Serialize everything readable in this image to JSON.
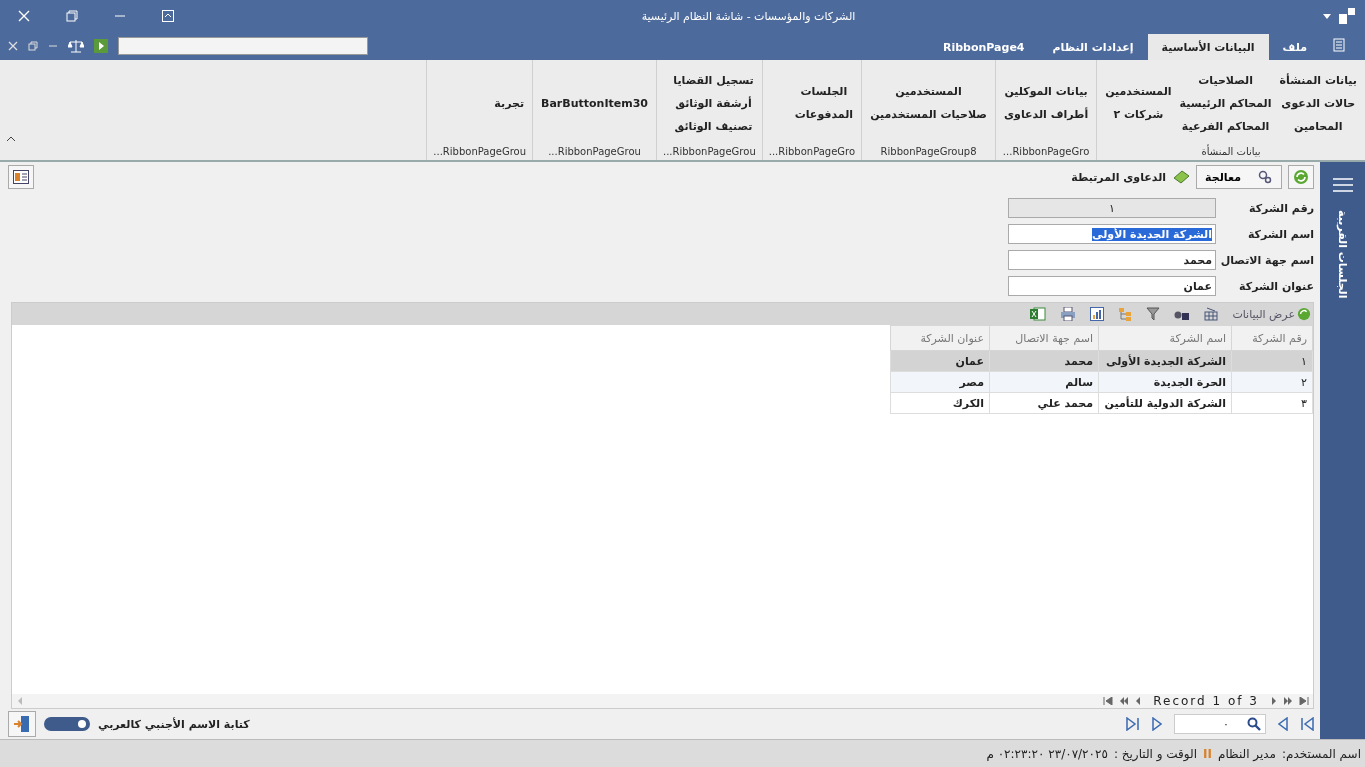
{
  "window": {
    "title": "الشركات والمؤسسات - شاشة النظام الرئيسية"
  },
  "ribbon": {
    "tabs": [
      {
        "label": "ملف",
        "selected": false
      },
      {
        "label": "البيانات الأساسية",
        "selected": true
      },
      {
        "label": "إعدادات النظام",
        "selected": false
      },
      {
        "label": "RibbonPage4",
        "selected": false
      }
    ],
    "groups": [
      {
        "caption": "بيانات المنشأة",
        "columns": [
          [
            "بيانات المنشأة",
            "حالات الدعوى",
            "المحامين"
          ],
          [
            "الصلاحيات",
            "المحاكم الرئيسية",
            "المحاكم الفرعية"
          ],
          [
            "المستخدمين",
            "شركات ٢"
          ]
        ]
      },
      {
        "caption": "RibbonPageGro...",
        "columns": [
          [
            "بيانات الموكلين",
            "أطراف الدعاوى"
          ]
        ]
      },
      {
        "caption": "RibbonPageGroup8",
        "columns": [
          [
            "المستخدمين",
            "صلاحيات المستخدمين"
          ]
        ]
      },
      {
        "caption": "RibbonPageGro...",
        "columns": [
          [
            "الجلسات",
            "المدفوعات"
          ]
        ]
      },
      {
        "caption": "RibbonPageGrou...",
        "columns": [
          [
            "تسجيل القضايا",
            "أرشفة الوثائق",
            "تصنيف الوثائق"
          ]
        ]
      },
      {
        "caption": "RibbonPageGrou...",
        "columns": [
          [
            "BarButtonItem30"
          ]
        ]
      },
      {
        "caption": "RibbonPageGrou...",
        "columns": [
          [
            "تجربة"
          ]
        ]
      }
    ]
  },
  "side_panel": {
    "title": "الجلسات القريبة"
  },
  "toolbar": {
    "process_label": "معالجة",
    "related_label": "الدعاوى المرتبطة"
  },
  "form": {
    "fields": [
      {
        "label": "رقم الشركة",
        "value": "١",
        "disabled": true,
        "highlighted": false
      },
      {
        "label": "اسم الشركة",
        "value": "الشركة الجديدة الأولى",
        "disabled": false,
        "highlighted": true
      },
      {
        "label": "اسم جهة الاتصال",
        "value": "محمد",
        "disabled": false,
        "highlighted": false
      },
      {
        "label": "عنوان الشركة",
        "value": "عمان",
        "disabled": false,
        "highlighted": false
      }
    ]
  },
  "grid": {
    "toolbar_label": "عرض البيانات",
    "columns": [
      "رقم الشركة",
      "اسم الشركة",
      "اسم جهة الاتصال",
      "عنوان الشركة"
    ],
    "rows": [
      {
        "cells": [
          "١",
          "الشركة الجديدة الأولى",
          "محمد",
          "عمان"
        ],
        "selected": true
      },
      {
        "cells": [
          "٢",
          "الحرة الجديدة",
          "سالم",
          "مصر"
        ],
        "selected": false
      },
      {
        "cells": [
          "٣",
          "الشركة الدولية للتأمين",
          "محمد علي",
          "الكرك"
        ],
        "selected": false
      }
    ],
    "record_label": "Record 1 of 3"
  },
  "bottom": {
    "toggle": {
      "label": "كتابة الاسم الأجنبي كالعربي",
      "on": true
    },
    "search_value": "٠"
  },
  "status_bar": {
    "user_label": "اسم المستخدم:",
    "user": "مدير النظام",
    "separator": "II",
    "datetime_label": "الوقت و التاريخ :",
    "datetime": "٢٣/٠٧/٢٠٢٥ ٠٢:٢٣:٢٠ م"
  }
}
